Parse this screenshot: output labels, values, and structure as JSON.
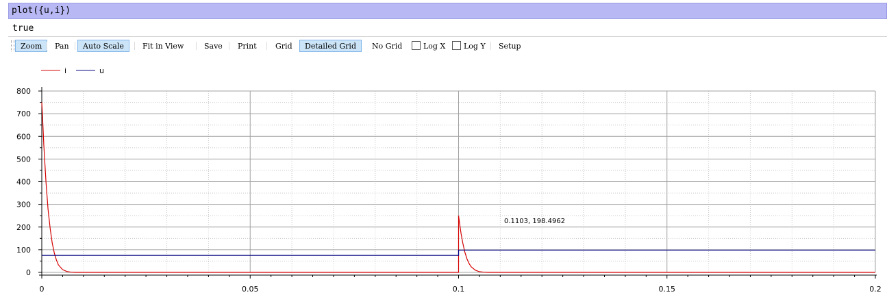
{
  "command": {
    "text": "plot({u,i})"
  },
  "result": {
    "text": "true"
  },
  "toolbar": {
    "zoom": "Zoom",
    "pan": "Pan",
    "auto_scale": "Auto Scale",
    "fit_in_view": "Fit in View",
    "save": "Save",
    "print": "Print",
    "grid": "Grid",
    "detailed_grid": "Detailed Grid",
    "no_grid": "No Grid",
    "log_x": "Log X",
    "log_y": "Log Y",
    "setup": "Setup"
  },
  "cursor_readout": "0.1103, 198.4962",
  "colors": {
    "i": "#d40000",
    "u": "#000080",
    "toolbar_active": "#cce4f7",
    "command_bar": "#b8b8f4"
  },
  "chart_data": {
    "type": "line",
    "title": "",
    "xlabel": "",
    "ylabel": "",
    "xlim": [
      0,
      0.2
    ],
    "ylim": [
      0,
      800
    ],
    "x_ticks": [
      "0",
      "0.05",
      "0.1",
      "0.15",
      "0.2"
    ],
    "y_ticks": [
      "0",
      "100",
      "200",
      "300",
      "400",
      "500",
      "600",
      "700",
      "800"
    ],
    "grid": "detailed",
    "legend_position": "top-left",
    "series": [
      {
        "name": "i",
        "color": "#d40000",
        "points": [
          [
            0,
            750
          ],
          [
            0.0002,
            680
          ],
          [
            0.0005,
            560
          ],
          [
            0.001,
            400
          ],
          [
            0.0015,
            280
          ],
          [
            0.002,
            195
          ],
          [
            0.0025,
            130
          ],
          [
            0.003,
            85
          ],
          [
            0.0035,
            55
          ],
          [
            0.004,
            33
          ],
          [
            0.005,
            12
          ],
          [
            0.006,
            4
          ],
          [
            0.007,
            1
          ],
          [
            0.008,
            0
          ],
          [
            0.1,
            0
          ],
          [
            0.1,
            250
          ],
          [
            0.1003,
            210
          ],
          [
            0.1006,
            170
          ],
          [
            0.101,
            130
          ],
          [
            0.1015,
            90
          ],
          [
            0.102,
            60
          ],
          [
            0.1025,
            40
          ],
          [
            0.103,
            25
          ],
          [
            0.104,
            10
          ],
          [
            0.105,
            3
          ],
          [
            0.106,
            1
          ],
          [
            0.107,
            0
          ],
          [
            0.2,
            0
          ]
        ]
      },
      {
        "name": "u",
        "color": "#000080",
        "points": [
          [
            0,
            75
          ],
          [
            0.1,
            75
          ],
          [
            0.1,
            98
          ],
          [
            0.2,
            98
          ]
        ]
      }
    ]
  }
}
